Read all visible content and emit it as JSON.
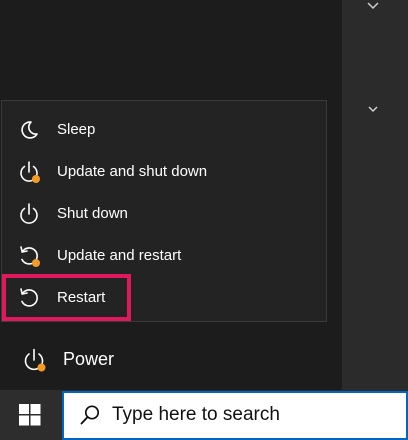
{
  "power_menu": {
    "items": [
      {
        "label": "Sleep",
        "icon": "moon-icon"
      },
      {
        "label": "Update and shut down",
        "icon": "power-update-icon"
      },
      {
        "label": "Shut down",
        "icon": "power-icon"
      },
      {
        "label": "Update and restart",
        "icon": "restart-update-icon"
      },
      {
        "label": "Restart",
        "icon": "restart-icon"
      }
    ],
    "highlighted_item": "Restart",
    "highlight_color": "#e0185e",
    "update_dot_color": "#f59a23"
  },
  "start_menu": {
    "power_label": "Power"
  },
  "taskbar": {
    "search_placeholder": "Type here to search",
    "accent_color": "#0067c0"
  }
}
